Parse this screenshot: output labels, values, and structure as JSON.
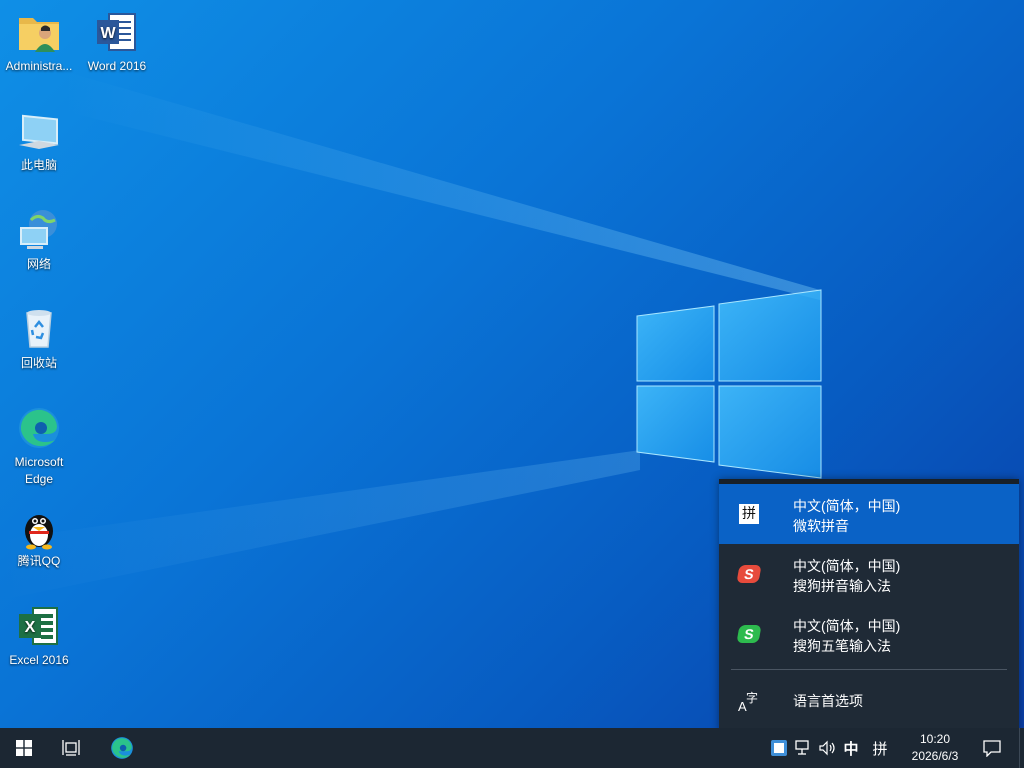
{
  "desktop": {
    "icons": [
      {
        "label": "Administra...",
        "icon": "user-folder-icon"
      },
      {
        "label": "Word 2016",
        "icon": "word-icon"
      },
      {
        "label": "此电脑",
        "icon": "computer-icon"
      },
      {
        "label": "网络",
        "icon": "network-icon"
      },
      {
        "label": "回收站",
        "icon": "recycle-bin-icon"
      },
      {
        "label": "Microsoft Edge",
        "icon": "edge-icon"
      },
      {
        "label": "腾讯QQ",
        "icon": "qq-icon"
      },
      {
        "label": "Excel 2016",
        "icon": "excel-icon"
      }
    ]
  },
  "ime_menu": {
    "items": [
      {
        "line1": "中文(简体，中国)",
        "line2": "微软拼音",
        "icon_text": "拼",
        "icon": "pinyin-icon",
        "selected": true
      },
      {
        "line1": "中文(简体，中国)",
        "line2": "搜狗拼音输入法",
        "icon_text": "S",
        "icon": "sogou-pinyin-icon"
      },
      {
        "line1": "中文(简体，中国)",
        "line2": "搜狗五笔输入法",
        "icon_text": "S",
        "icon": "sogou-wubi-icon"
      }
    ],
    "language_prefs": {
      "label": "语言首选项",
      "icon": "language-preferences-icon"
    }
  },
  "taskbar": {
    "start_icon": "windows-start-icon",
    "taskview_icon": "task-view-icon",
    "edge_icon": "edge-icon",
    "tray": {
      "ime_mode": "中",
      "ime_layout": "拼",
      "time": "10:20",
      "date": "2026/6/3"
    }
  },
  "colors": {
    "taskbar_bg": "#1c2733",
    "menu_bg": "#1f2a36",
    "menu_selected": "#0a62c6",
    "desktop_blue": "#0a74d6"
  }
}
